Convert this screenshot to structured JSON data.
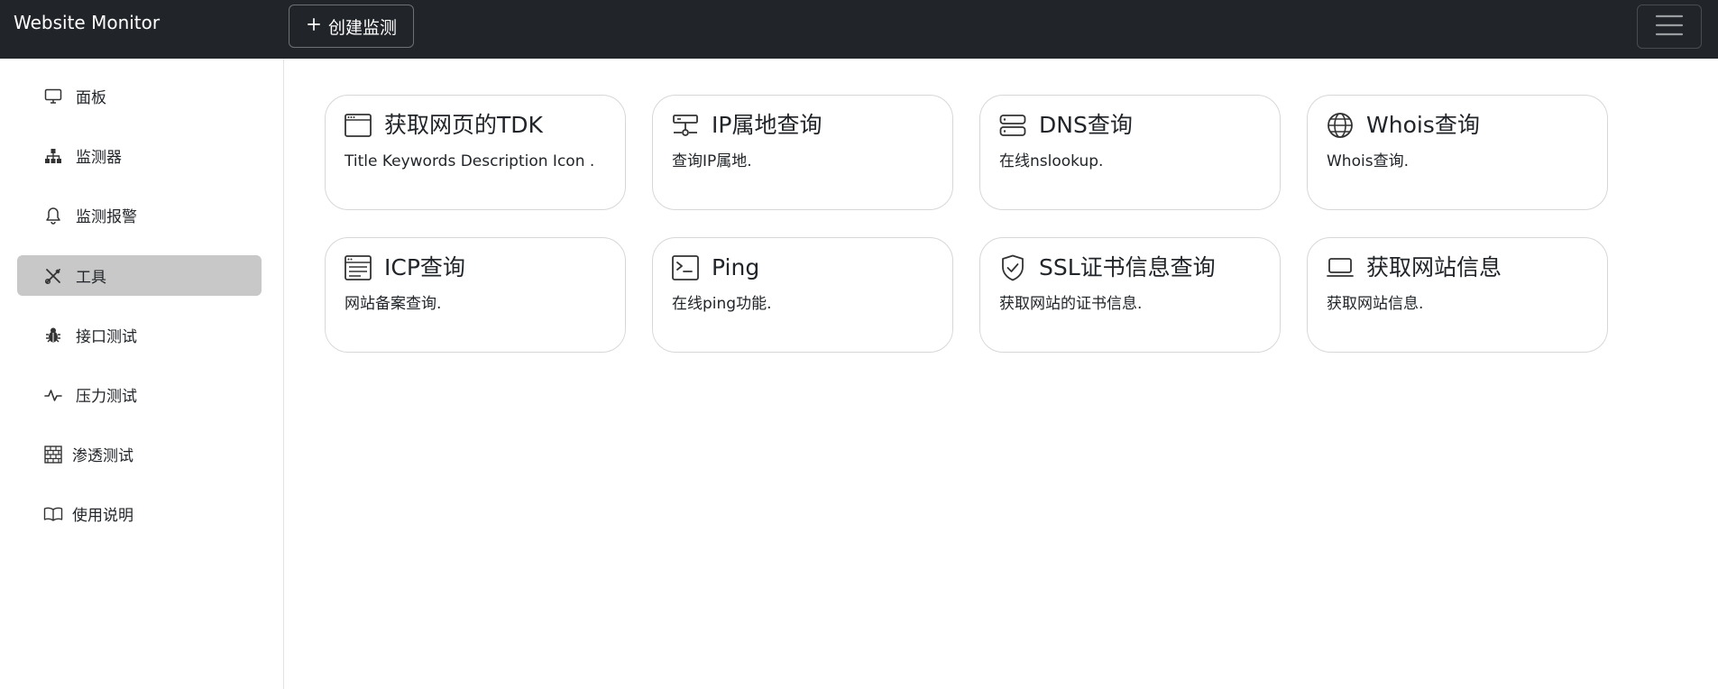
{
  "navbar": {
    "brand": "Website Monitor",
    "create_button": "创建监测"
  },
  "sidebar": {
    "items": [
      {
        "label": "面板",
        "icon": "monitor-icon"
      },
      {
        "label": "监测器",
        "icon": "diagram-icon"
      },
      {
        "label": "监测报警",
        "icon": "bell-icon"
      },
      {
        "label": "工具",
        "icon": "tools-icon",
        "active": true
      },
      {
        "label": "接口测试",
        "icon": "bug-icon"
      },
      {
        "label": "压力测试",
        "icon": "activity-icon"
      },
      {
        "label": "渗透测试",
        "icon": "bricks-icon"
      },
      {
        "label": "使用说明",
        "icon": "book-icon"
      }
    ]
  },
  "tools": [
    {
      "title": "获取网页的TDK",
      "desc": "Title Keywords Description Icon .",
      "icon": "window-icon"
    },
    {
      "title": "IP属地查询",
      "desc": "查询IP属地.",
      "icon": "ethernet-icon"
    },
    {
      "title": "DNS查询",
      "desc": "在线nslookup.",
      "icon": "server-icon"
    },
    {
      "title": "Whois查询",
      "desc": "Whois查询.",
      "icon": "globe-icon"
    },
    {
      "title": "ICP查询",
      "desc": "网站备案查询.",
      "icon": "list-window-icon"
    },
    {
      "title": "Ping",
      "desc": "在线ping功能.",
      "icon": "terminal-icon"
    },
    {
      "title": "SSL证书信息查询",
      "desc": "获取网站的证书信息.",
      "icon": "shield-check-icon"
    },
    {
      "title": "获取网站信息",
      "desc": "获取网站信息.",
      "icon": "laptop-icon"
    }
  ]
}
